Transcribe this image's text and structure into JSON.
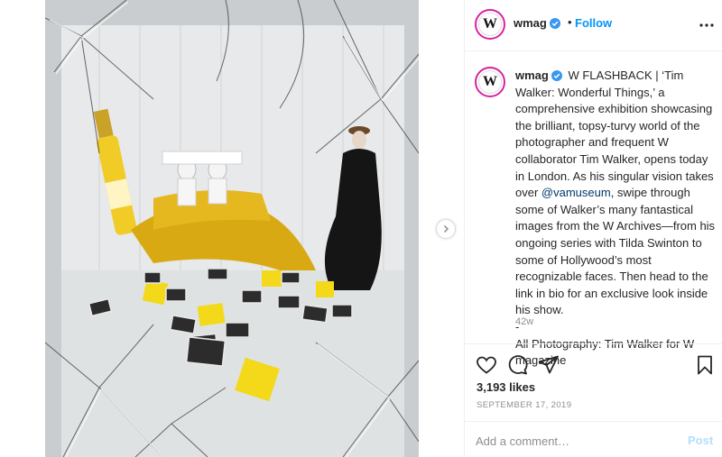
{
  "post": {
    "username": "wmag",
    "verified": true,
    "avatar_letter": "W",
    "follow_label": "Follow",
    "separator": "•",
    "caption_parts": [
      "W FLASHBACK | ‘Tim Walker: Wonderful Things,’ a comprehensive exhibition showcasing the brilliant, topsy-turvy world of the photographer and frequent W collaborator Tim Walker, opens today in London. As his singular vision takes over ",
      "@vamuseum",
      ", swipe through some of Walker’s many fantastical images from the W Archives—from his ongoing series with Tilda Swinton to some of Hollywood’s most recognizable faces. Then head to the link in bio for an exclusive look inside his show."
    ],
    "caption_dash": "-",
    "caption_credit": "All Photography: Tim Walker for W magazine",
    "time_ago": "42w",
    "likes": "3,193 likes",
    "date": "SEPTEMBER 17, 2019"
  },
  "comment": {
    "placeholder": "Add a comment…",
    "post_label": "Post"
  },
  "icons": {
    "verified": "verified-badge-icon",
    "more": "more-options-icon",
    "like": "heart-icon",
    "comment": "comment-bubble-icon",
    "share": "paper-plane-icon",
    "save": "bookmark-icon",
    "next": "chevron-right-icon"
  },
  "colors": {
    "link": "#0095f6",
    "mention": "#00376b",
    "story_ring": "#d6249f",
    "post_disabled": "#b2dffc",
    "muted": "#8e8e8e"
  }
}
